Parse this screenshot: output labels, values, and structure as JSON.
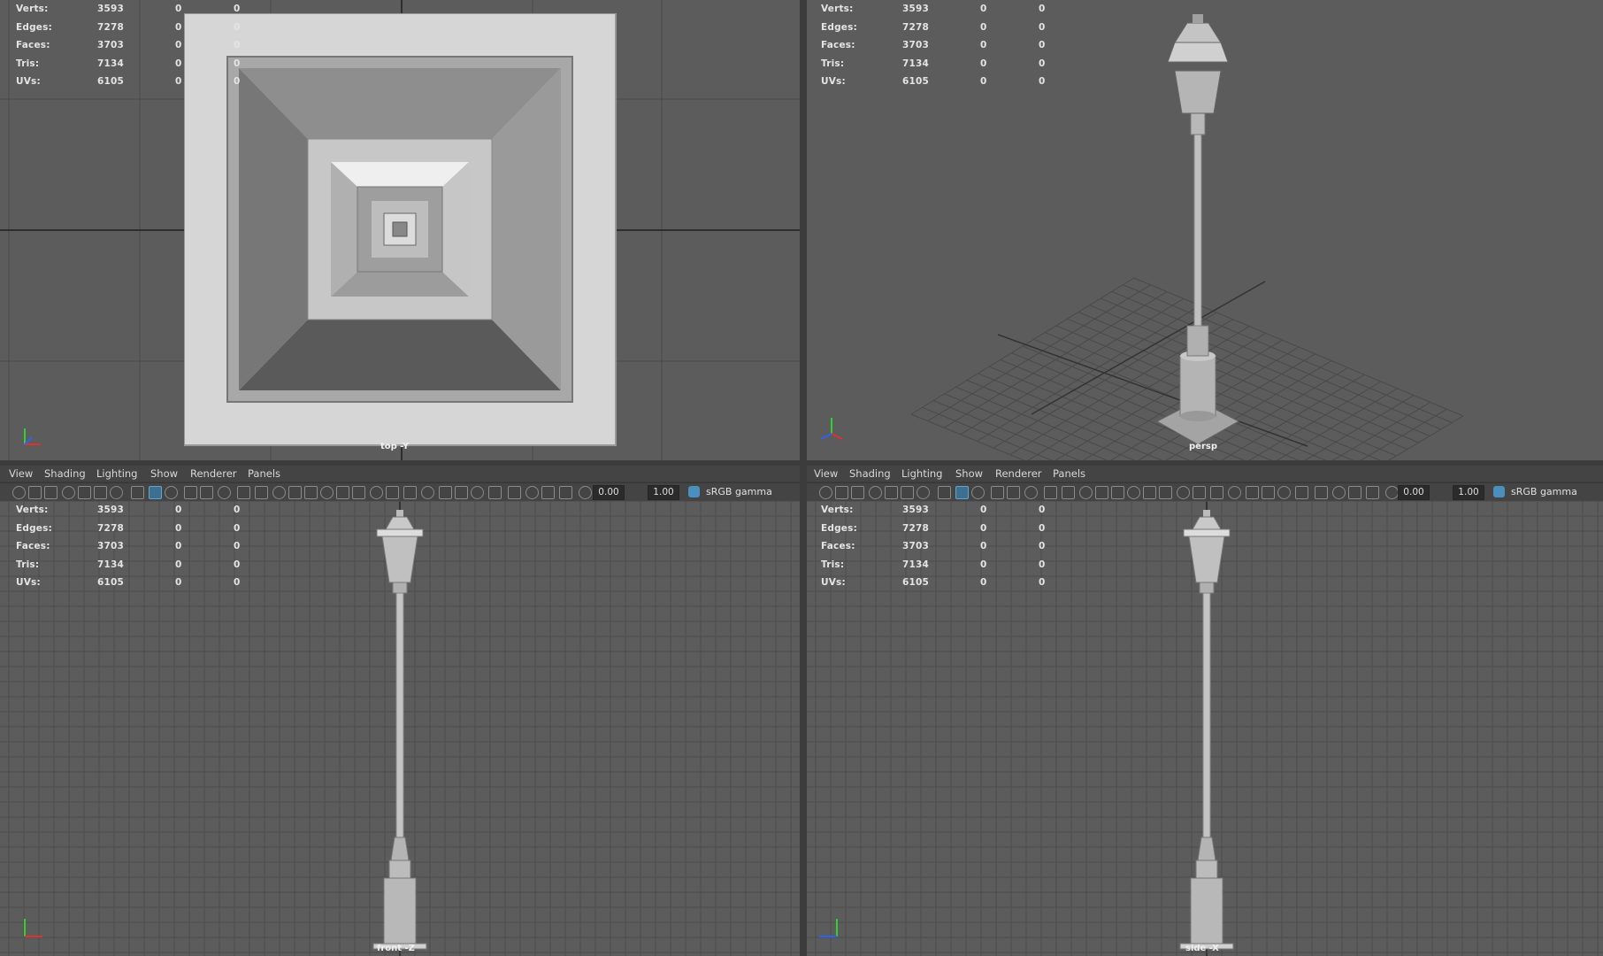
{
  "stats": {
    "rows": [
      {
        "label": "Verts:",
        "v1": "3593",
        "v2": "0",
        "v3": "0"
      },
      {
        "label": "Edges:",
        "v1": "7278",
        "v2": "0",
        "v3": "0"
      },
      {
        "label": "Faces:",
        "v1": "3703",
        "v2": "0",
        "v3": "0"
      },
      {
        "label": "Tris:",
        "v1": "7134",
        "v2": "0",
        "v3": "0"
      },
      {
        "label": "UVs:",
        "v1": "6105",
        "v2": "0",
        "v3": "0"
      }
    ]
  },
  "menu": {
    "view": "View",
    "shading": "Shading",
    "lighting": "Lighting",
    "show": "Show",
    "renderer": "Renderer",
    "panels": "Panels"
  },
  "toolbar": {
    "exposure": "0.00",
    "gamma": "1.00",
    "colorspace": "sRGB gamma"
  },
  "viewports": {
    "top": {
      "camera": "top -Y"
    },
    "persp": {
      "camera": "persp"
    },
    "front": {
      "camera": "front -Z"
    },
    "side": {
      "camera": "side -X"
    }
  },
  "colors": {
    "viewport_bg": "#5c5c5c",
    "grid_line": "#4f4f4f",
    "accent": "#5aa6d6",
    "axis_x": "#e03030",
    "axis_y": "#30d030",
    "axis_z": "#3060f0"
  }
}
